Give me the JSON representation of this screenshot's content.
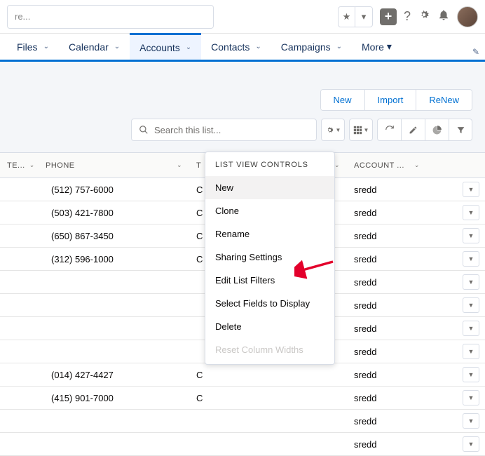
{
  "global_search_placeholder": "re...",
  "nav": {
    "items": [
      "Files",
      "Calendar",
      "Accounts",
      "Contacts",
      "Campaigns"
    ],
    "more": "More",
    "active_index": 2
  },
  "actions": {
    "new": "New",
    "import": "Import",
    "renew": "ReNew"
  },
  "list_search_placeholder": "Search this list...",
  "columns": {
    "c1": "TE...",
    "c2": "PHONE",
    "c3": "T",
    "c4": "ACCOUNT ..."
  },
  "rows": [
    {
      "phone": "(512) 757-6000",
      "type": "C",
      "owner": "sredd"
    },
    {
      "phone": "(503) 421-7800",
      "type": "C",
      "owner": "sredd"
    },
    {
      "phone": "(650) 867-3450",
      "type": "C",
      "owner": "sredd"
    },
    {
      "phone": "(312) 596-1000",
      "type": "C",
      "owner": "sredd"
    },
    {
      "phone": "",
      "type": "",
      "owner": "sredd"
    },
    {
      "phone": "",
      "type": "",
      "owner": "sredd"
    },
    {
      "phone": "",
      "type": "",
      "owner": "sredd"
    },
    {
      "phone": "",
      "type": "",
      "owner": "sredd"
    },
    {
      "phone": "(014) 427-4427",
      "type": "C",
      "owner": "sredd"
    },
    {
      "phone": "(415) 901-7000",
      "type": "C",
      "owner": "sredd"
    },
    {
      "phone": "",
      "type": "",
      "owner": "sredd"
    },
    {
      "phone": "",
      "type": "",
      "owner": "sredd"
    }
  ],
  "popover": {
    "title": "LIST VIEW CONTROLS",
    "items": [
      "New",
      "Clone",
      "Rename",
      "Sharing Settings",
      "Edit List Filters",
      "Select Fields to Display",
      "Delete",
      "Reset Column Widths"
    ],
    "hovered_index": 0,
    "disabled_index": 7
  }
}
